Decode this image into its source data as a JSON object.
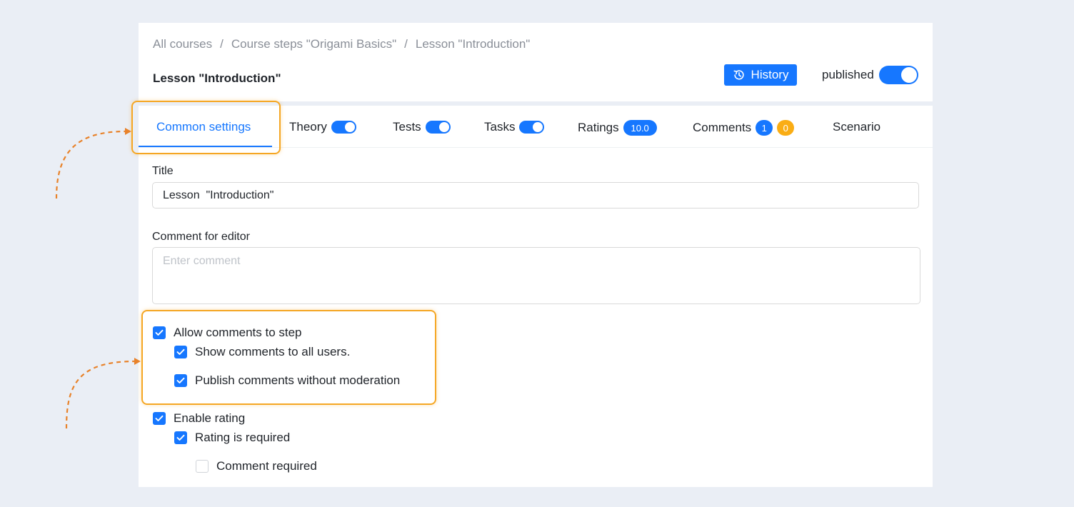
{
  "header": {
    "breadcrumb": [
      "All courses",
      "Course steps \"Origami Basics\"",
      "Lesson \"Introduction\""
    ],
    "breadcrumb_separator": "/",
    "page_title": "Lesson \"Introduction\"",
    "history_label": "History",
    "published_label": "published"
  },
  "tabs": [
    {
      "label": "Common settings",
      "active": true
    },
    {
      "label": "Theory",
      "toggle": true
    },
    {
      "label": "Tests",
      "toggle": true
    },
    {
      "label": "Tasks",
      "toggle": true
    },
    {
      "label": "Ratings",
      "badge": "10.0"
    },
    {
      "label": "Comments",
      "badges": [
        "1",
        "0"
      ]
    },
    {
      "label": "Scenario"
    }
  ],
  "form": {
    "title_label": "Title",
    "title_value": "Lesson  \"Introduction\"",
    "comment_label": "Comment for editor",
    "comment_placeholder": "Enter comment",
    "checkboxes": [
      {
        "label": "Allow comments to step",
        "checked": true
      },
      {
        "label": "Show comments to all users.",
        "checked": true
      },
      {
        "label": "Publish comments without moderation",
        "checked": true
      },
      {
        "label": "Enable rating",
        "checked": true
      },
      {
        "label": "Rating is required",
        "checked": true
      },
      {
        "label": "Comment required",
        "checked": false
      }
    ]
  },
  "colors": {
    "primary": "#1677ff",
    "warning": "#faad14",
    "highlight": "#f5a623",
    "arrow": "#e8822a",
    "page_bg": "#eaeef5"
  }
}
